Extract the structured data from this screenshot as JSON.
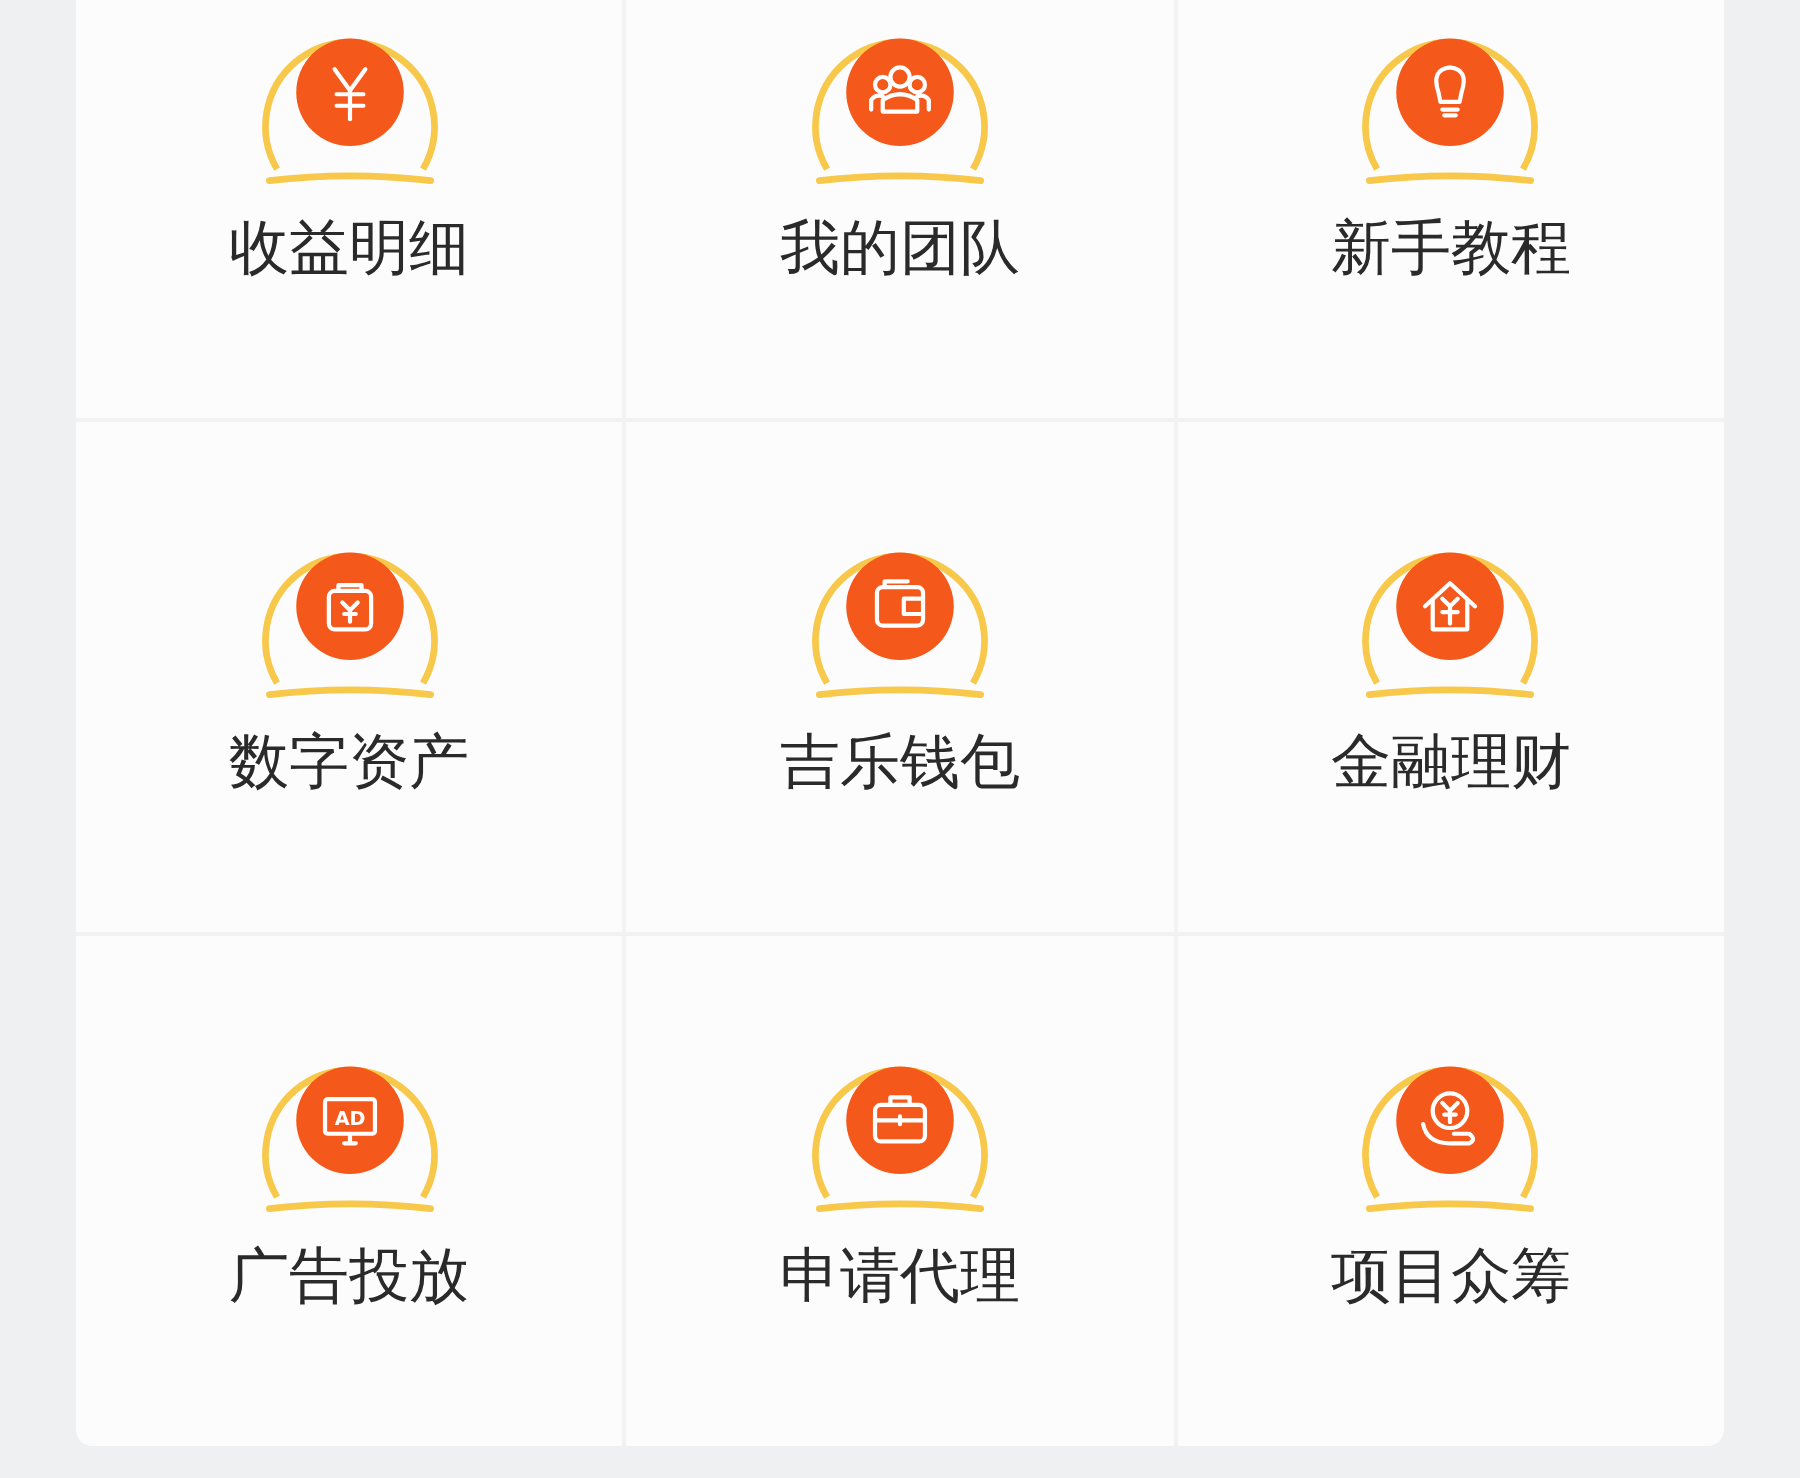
{
  "menu": [
    {
      "label": "收益明细",
      "kind": "yen"
    },
    {
      "label": "我的团队",
      "kind": "team"
    },
    {
      "label": "新手教程",
      "kind": "bulb"
    },
    {
      "label": "数字资产",
      "kind": "bag"
    },
    {
      "label": "吉乐钱包",
      "kind": "wallet"
    },
    {
      "label": "金融理财",
      "kind": "house"
    },
    {
      "label": "广告投放",
      "kind": "ad",
      "icon_text": "AD"
    },
    {
      "label": "申请代理",
      "kind": "briefcase"
    },
    {
      "label": "项目众筹",
      "kind": "coin-hand"
    }
  ]
}
